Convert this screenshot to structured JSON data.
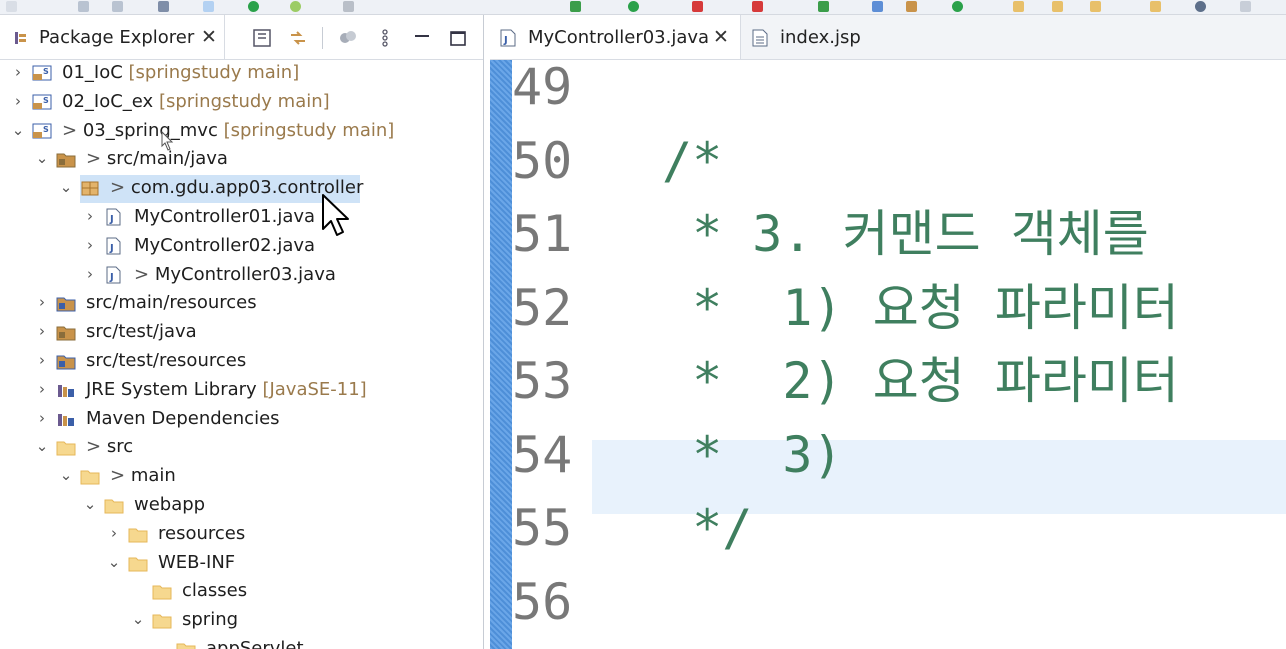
{
  "explorer": {
    "tab_label": "Package Explorer",
    "tab_close": "✕",
    "tree": [
      {
        "chevron": "›",
        "label": "01_IoC",
        "decor": "[springstudy main]",
        "icon": "maven-project-icon",
        "indent": 0
      },
      {
        "chevron": "›",
        "label": "02_IoC_ex",
        "decor": "[springstudy main]",
        "icon": "maven-project-icon",
        "indent": 0
      },
      {
        "chevron": "⌄",
        "prefix": ">",
        "label": "03_spring_mvc",
        "decor": "[springstudy main]",
        "icon": "maven-project-icon",
        "indent": 0
      },
      {
        "chevron": "⌄",
        "prefix": ">",
        "label": "src/main/java",
        "icon": "source-folder-icon",
        "indent": 1
      },
      {
        "chevron": "⌄",
        "prefix": ">",
        "label": "com.gdu.app03.controller",
        "icon": "package-icon",
        "indent": 2,
        "selected": true
      },
      {
        "chevron": "›",
        "label": "MyController01.java",
        "icon": "java-file-icon",
        "indent": 3
      },
      {
        "chevron": "›",
        "label": "MyController02.java",
        "icon": "java-file-icon",
        "indent": 3
      },
      {
        "chevron": "›",
        "prefix": ">",
        "label": "MyController03.java",
        "icon": "java-file-icon",
        "indent": 3
      },
      {
        "chevron": "›",
        "label": "src/main/resources",
        "icon": "resource-folder-icon",
        "indent": 1
      },
      {
        "chevron": "›",
        "label": "src/test/java",
        "icon": "source-folder-icon",
        "indent": 1
      },
      {
        "chevron": "›",
        "label": "src/test/resources",
        "icon": "resource-folder-icon",
        "indent": 1
      },
      {
        "chevron": "›",
        "label": "JRE System Library",
        "decor": "[JavaSE-11]",
        "icon": "library-icon",
        "indent": 1
      },
      {
        "chevron": "›",
        "label": "Maven Dependencies",
        "icon": "library-icon",
        "indent": 1
      },
      {
        "chevron": "⌄",
        "prefix": ">",
        "label": "src",
        "icon": "folder-icon",
        "indent": 1
      },
      {
        "chevron": "⌄",
        "prefix": ">",
        "label": "main",
        "icon": "folder-icon",
        "indent": 2
      },
      {
        "chevron": "⌄",
        "label": "webapp",
        "icon": "folder-icon",
        "indent": 3
      },
      {
        "chevron": "›",
        "label": "resources",
        "icon": "folder-icon",
        "indent": 4
      },
      {
        "chevron": "⌄",
        "label": "WEB-INF",
        "icon": "folder-icon",
        "indent": 4
      },
      {
        "chevron": "",
        "label": "classes",
        "icon": "folder-icon",
        "indent": 5
      },
      {
        "chevron": "⌄",
        "label": "spring",
        "icon": "folder-icon",
        "indent": 5
      },
      {
        "chevron": "⌄",
        "label": "appServlet",
        "icon": "folder-icon",
        "indent": 6
      }
    ]
  },
  "editor": {
    "tabs": [
      {
        "label": "MyController03.java",
        "close": "✕",
        "active": true
      },
      {
        "label": "index.jsp",
        "active": false
      }
    ],
    "lines": [
      {
        "num": "49",
        "text": ""
      },
      {
        "num": "50",
        "text": "/*"
      },
      {
        "num": "51",
        "text": " * 3. 커맨드 객체를"
      },
      {
        "num": "52",
        "text": " *  1) 요청 파라미터"
      },
      {
        "num": "53",
        "text": " *  2) 요청 파라미터"
      },
      {
        "num": "54",
        "text": " *  3)"
      },
      {
        "num": "55",
        "text": " */"
      },
      {
        "num": "56",
        "text": ""
      }
    ]
  },
  "colors": {
    "comment": "#3f7f5f",
    "line_number": "#787878",
    "selection": "#cfe3f7",
    "current_line": "#e8f2fc"
  }
}
